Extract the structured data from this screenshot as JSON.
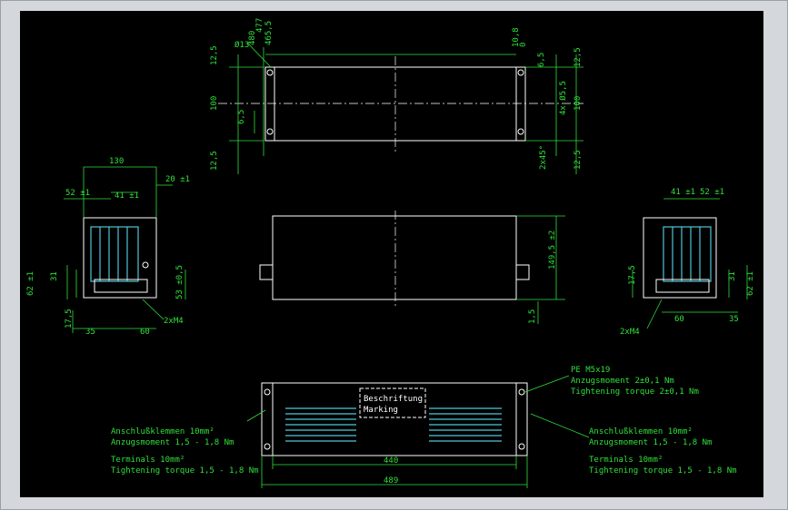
{
  "top_view": {
    "phi": "Ø13",
    "d477": "477",
    "d480": "480",
    "d465": "465,5",
    "d12_5a": "12,5",
    "d100": "100",
    "d6_5": "6,5",
    "d12_5b": "12,5",
    "d10_8": "10,8",
    "d0": "0",
    "d6_5r": "6,5",
    "d12_5r": "12,5",
    "holes": "4x Ø5,5",
    "d100r": "100",
    "d2x45": "2x45°",
    "d12_5rb": "12,5"
  },
  "left_view": {
    "d130": "130",
    "d52": "52 ±1",
    "d41": "41 ±1",
    "d20": "20 ±1",
    "d62": "62 ±1",
    "d31": "31",
    "d17_5": "17,5",
    "d53": "53 ±0,5",
    "d35": "35",
    "d60": "60",
    "screw": "2xM4"
  },
  "front_view": {
    "d149": "149,5 ±2",
    "d1_5": "1,5"
  },
  "right_view": {
    "d41": "41 ±1",
    "d52": "52 ±1",
    "d17_5": "17,5",
    "d31": "31",
    "d62": "62 ±1",
    "d60": "60",
    "d35": "35",
    "screw": "2xM4"
  },
  "bottom_view": {
    "label_1": "Beschriftung",
    "label_2": "Marking",
    "d440": "440",
    "d489": "489",
    "pe_1": "PE M5x19",
    "pe_2": "Anzugsmoment 2±0,1 Nm",
    "pe_3": "Tightening torque 2±0,1 Nm",
    "left_1": "Anschlußklemmen 10mm²",
    "left_2": "Anzugsmoment 1,5 - 1,8 Nm",
    "left_3": "Terminals 10mm²",
    "left_4": "Tightening torque 1,5 - 1,8 Nm",
    "right_1": "Anschlußklemmen 10mm²",
    "right_2": "Anzugsmoment 1,5 - 1,8 Nm",
    "right_3": "Terminals 10mm²",
    "right_4": "Tightening torque 1,5 - 1,8 Nm"
  },
  "colors": {
    "background": "#000000",
    "dimension": "#2fe03a",
    "outline": "#ffffff",
    "terminal": "#4fc6d8"
  }
}
